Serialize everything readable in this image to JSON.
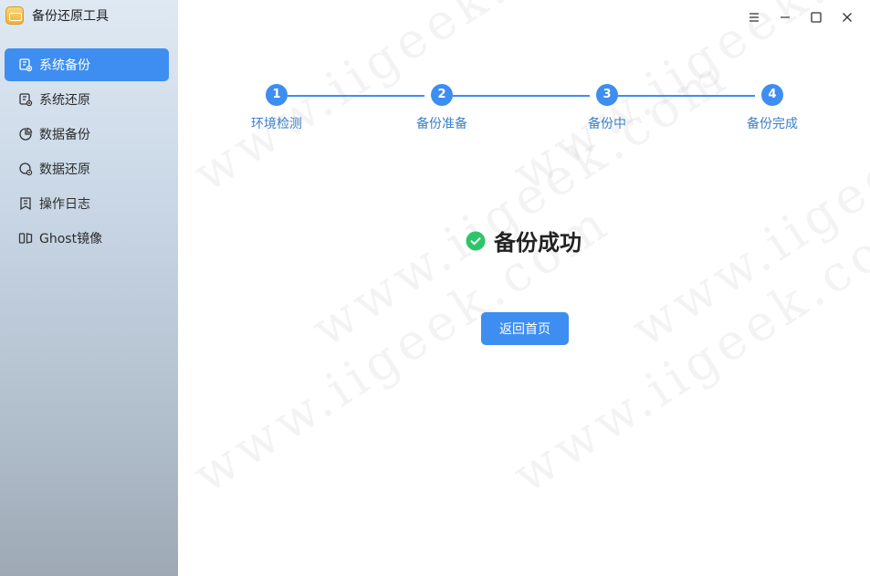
{
  "app": {
    "title": "备份还原工具"
  },
  "sidebar": {
    "items": [
      {
        "label": "系统备份",
        "icon": "system-backup-icon",
        "active": true
      },
      {
        "label": "系统还原",
        "icon": "system-restore-icon",
        "active": false
      },
      {
        "label": "数据备份",
        "icon": "data-backup-icon",
        "active": false
      },
      {
        "label": "数据还原",
        "icon": "data-restore-icon",
        "active": false
      },
      {
        "label": "操作日志",
        "icon": "log-icon",
        "active": false
      },
      {
        "label": "Ghost镜像",
        "icon": "ghost-image-icon",
        "active": false
      }
    ]
  },
  "window_controls": [
    "menu-icon",
    "minimize-icon",
    "maximize-icon",
    "close-icon"
  ],
  "stepper": {
    "steps": [
      {
        "number": "1",
        "label": "环境检测"
      },
      {
        "number": "2",
        "label": "备份准备"
      },
      {
        "number": "3",
        "label": "备份中"
      },
      {
        "number": "4",
        "label": "备份完成"
      }
    ],
    "current_step": 4
  },
  "result": {
    "text": "备份成功",
    "icon": "success-check-icon"
  },
  "actions": {
    "home_label": "返回首页"
  },
  "watermark": {
    "text": "www.iigeek.com"
  },
  "colors": {
    "accent": "#3d8ef0",
    "success": "#2ec56a",
    "step_label": "#3a7fc8"
  }
}
